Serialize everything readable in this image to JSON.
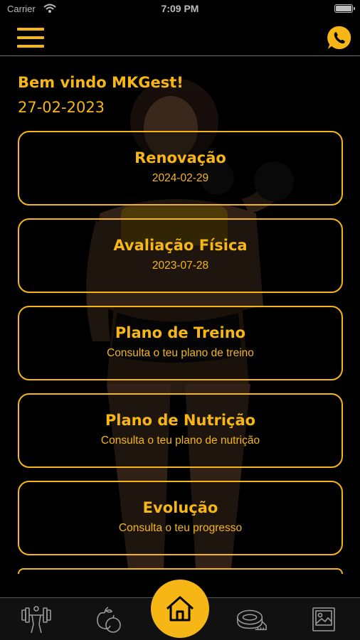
{
  "status_bar": {
    "carrier": "Carrier",
    "time": "7:09 PM"
  },
  "header": {
    "menu_icon": "hamburger-menu-icon",
    "contact_icon": "whatsapp-icon"
  },
  "welcome": {
    "greeting": "Bem vindo MKGest!",
    "date": "27-02-2023"
  },
  "cards": [
    {
      "title": "Renovação",
      "subtitle": "2024-02-29"
    },
    {
      "title": "Avaliação Física",
      "subtitle": "2023-07-28"
    },
    {
      "title": "Plano de Treino",
      "subtitle": "Consulta o teu plano de treino"
    },
    {
      "title": "Plano de Nutrição",
      "subtitle": "Consulta o teu plano de nutrição"
    },
    {
      "title": "Evolução",
      "subtitle": "Consulta o teu progresso"
    }
  ],
  "tabbar": {
    "items": [
      {
        "icon": "workout-dumbbell-icon"
      },
      {
        "icon": "nutrition-fruit-icon"
      },
      {
        "icon": "home-icon",
        "active": true
      },
      {
        "icon": "measuring-tape-icon"
      },
      {
        "icon": "gallery-image-icon"
      }
    ]
  },
  "colors": {
    "accent": "#f5b616",
    "background": "#000000",
    "tabbar": "#111111"
  }
}
